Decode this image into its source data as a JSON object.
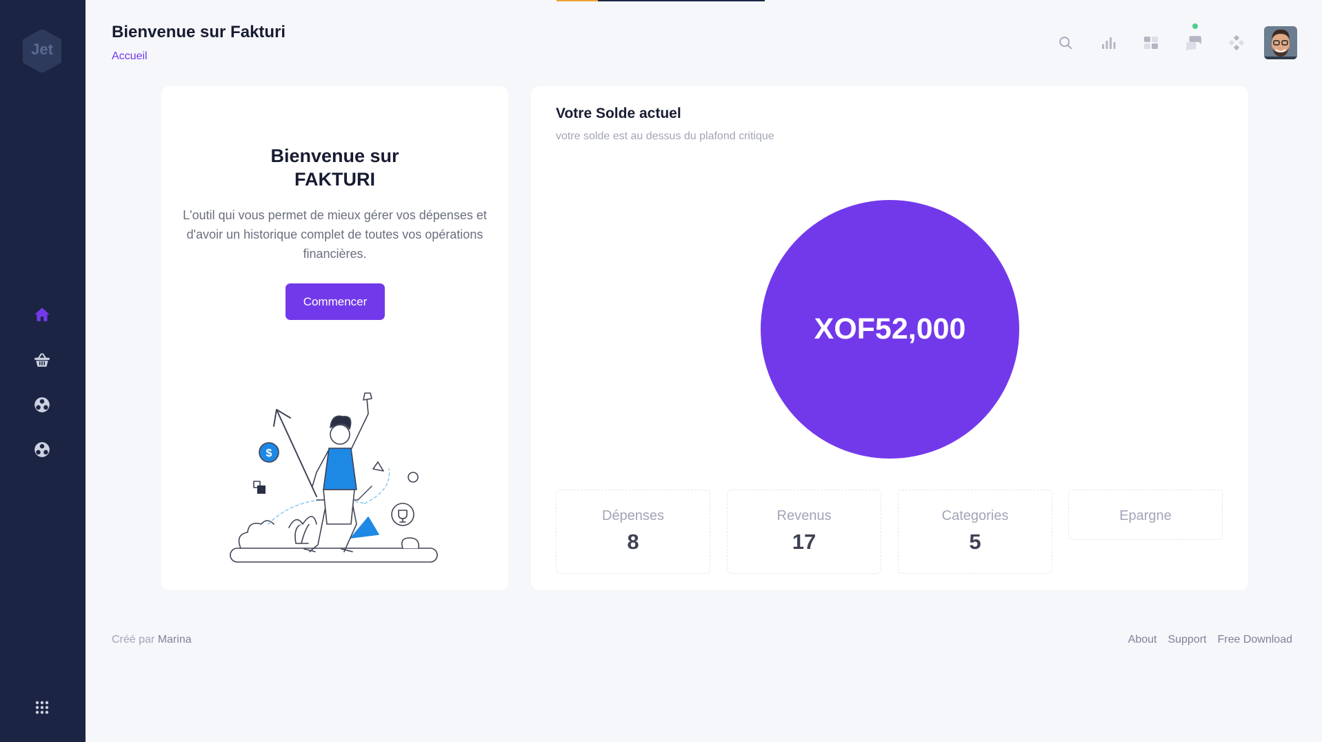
{
  "app": {
    "logo_text": "Jet"
  },
  "header": {
    "title": "Bienvenue sur Fakturi",
    "breadcrumb": "Accueil"
  },
  "sidebar": {
    "items": [
      {
        "icon": "home-icon",
        "active": true
      },
      {
        "icon": "basket-icon",
        "active": false
      },
      {
        "icon": "orbit-icon",
        "active": false
      },
      {
        "icon": "orbit-icon",
        "active": false
      }
    ],
    "bottom_icon": "apps-grid-icon"
  },
  "toolbar": {
    "icons": [
      "search-icon",
      "chart-icon",
      "grid-icon",
      "chat-icon",
      "diamond-grid-icon"
    ],
    "notification_dot_color": "#50cd89"
  },
  "welcome_card": {
    "title_line1": "Bienvenue sur",
    "title_line2": "FAKTURI",
    "description": "L'outil qui vous permet de mieux gérer vos dépenses et d'avoir un historique complet de toutes vos opérations financières.",
    "button_label": "Commencer"
  },
  "balance_card": {
    "title": "Votre Solde actuel",
    "subtitle": "votre solde est au dessus du plafond critique",
    "amount": "XOF52,000",
    "stats": [
      {
        "label": "Dépenses",
        "value": "8"
      },
      {
        "label": "Revenus",
        "value": "17"
      },
      {
        "label": "Categories",
        "value": "5"
      },
      {
        "label": "Epargne",
        "value": ""
      }
    ]
  },
  "footer": {
    "created_by": "Créé par",
    "author": "Marina",
    "links": [
      "About",
      "Support",
      "Free Download"
    ]
  },
  "colors": {
    "accent": "#7239ea",
    "sidebar": "#1b2543",
    "background": "#f5f7fb"
  }
}
